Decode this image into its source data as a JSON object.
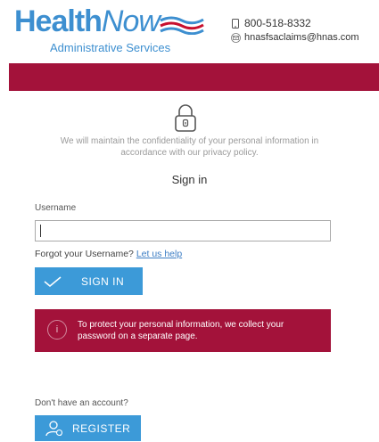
{
  "header": {
    "logo_health": "Health",
    "logo_now": "Now",
    "logo_subtitle": "Administrative Services",
    "phone": "800-518-8332",
    "email": "hnasfsaclaims@hnas.com"
  },
  "colors": {
    "brand_blue": "#3d8fd0",
    "brand_red": "#a3123a",
    "button_blue": "#3c9ad8"
  },
  "icons": {
    "phone": "phone-icon",
    "email": "envelope-icon",
    "lock": "lock-icon",
    "check": "check-icon",
    "info": "info-icon",
    "user": "user-icon"
  },
  "privacy": {
    "line1": "We will maintain the confidentiality of your personal information in",
    "line2": "accordance with our privacy policy."
  },
  "signin": {
    "heading": "Sign in",
    "username_label": "Username",
    "username_value": "",
    "forgot_text": "Forgot your Username?",
    "forgot_link": "Let us help",
    "button_label": "SIGN IN"
  },
  "notice": {
    "line1": "To protect your personal information, we collect your",
    "line2": "password on a separate page."
  },
  "register": {
    "prompt": "Don't have an account?",
    "button_label": "REGISTER"
  }
}
